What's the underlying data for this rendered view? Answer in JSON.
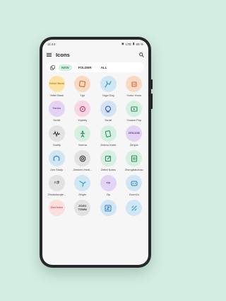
{
  "status": {
    "time": "11:44",
    "network": "LTE",
    "battery": "65 %"
  },
  "app": {
    "title": "Icons"
  },
  "tabs": [
    "NEW",
    "FOLDER",
    "ALL"
  ],
  "icons": [
    {
      "label": "Yettel Bank",
      "text": "Yettel Bank",
      "bg": "#fbe3a8",
      "fg": "#b78b13",
      "glyph": "text"
    },
    {
      "label": "Ygo",
      "bg": "#fad9c2",
      "fg": "#c8683a",
      "glyph": "square"
    },
    {
      "label": "Yoga Dog",
      "bg": "#cfe6f3",
      "fg": "#3a9bc8",
      "glyph": "dog"
    },
    {
      "label": "Yomu Yomu",
      "bg": "#fad9c2",
      "fg": "#c8683a",
      "glyph": "robot"
    },
    {
      "label": "Yonks",
      "text": "Yonks",
      "bg": "#e3d4f3",
      "fg": "#7a4bb5",
      "glyph": "text"
    },
    {
      "label": "Yoperty",
      "bg": "#f6d6e3",
      "fg": "#c84478",
      "glyph": "pin"
    },
    {
      "label": "Yousit",
      "bg": "#d5e2f3",
      "fg": "#3a68c8",
      "glyph": "chat"
    },
    {
      "label": "Youave Pop",
      "bg": "#d5efe1",
      "fg": "#2f8a5a",
      "glyph": "play"
    },
    {
      "label": "Youtify",
      "bg": "#e2e2e2",
      "fg": "#333333",
      "glyph": "wave"
    },
    {
      "label": "Yuema",
      "bg": "#d5efe1",
      "fg": "#2f8a5a",
      "glyph": "person"
    },
    {
      "label": "Zeleno Karta",
      "bg": "#d5efe1",
      "fg": "#2f8a5a",
      "glyph": "cards"
    },
    {
      "label": "Zenjob",
      "text": "ZENJOB",
      "bg": "#e3d4f3",
      "fg": "#6a3fa8",
      "glyph": "text"
    },
    {
      "label": "Zen Study",
      "bg": "#cfe6f3",
      "fg": "#3a7bc8",
      "glyph": "arc"
    },
    {
      "label": "Zenkren Hedi...",
      "bg": "#e2e2e2",
      "fg": "#333333",
      "glyph": "camera"
    },
    {
      "label": "Zettel Notes",
      "bg": "#d5efe1",
      "fg": "#2f8a5a",
      "glyph": "note"
    },
    {
      "label": "Zhengbanzhao",
      "bg": "#d5efe1",
      "fg": "#2f8a5a",
      "glyph": "doc"
    },
    {
      "label": "Zhuiduiaoqie...",
      "text": "八字",
      "bg": "#e2e2e2",
      "fg": "#333333",
      "glyph": "text"
    },
    {
      "label": "Zinghr",
      "bg": "#cfe6f3",
      "fg": "#3a9bc8",
      "glyph": "bird"
    },
    {
      "label": "Zip",
      "text": "zip",
      "bg": "#e3d4f3",
      "fg": "#6a3fa8",
      "glyph": "text"
    },
    {
      "label": "Zoom2u",
      "bg": "#cfe6f3",
      "fg": "#3a7bc8",
      "glyph": "face"
    },
    {
      "label": "",
      "text": "Zoo boro",
      "bg": "#fbdede",
      "fg": "#d94a4a",
      "glyph": "text"
    },
    {
      "label": "",
      "text": "ZOZO TOWN",
      "bg": "#e2e2e2",
      "fg": "#333333",
      "glyph": "text"
    },
    {
      "label": "",
      "bg": "#cfe6f3",
      "fg": "#3a7bc8",
      "glyph": "zsquare"
    },
    {
      "label": "",
      "bg": "#cfe6f3",
      "fg": "#3a9bc8",
      "glyph": "slash"
    }
  ]
}
